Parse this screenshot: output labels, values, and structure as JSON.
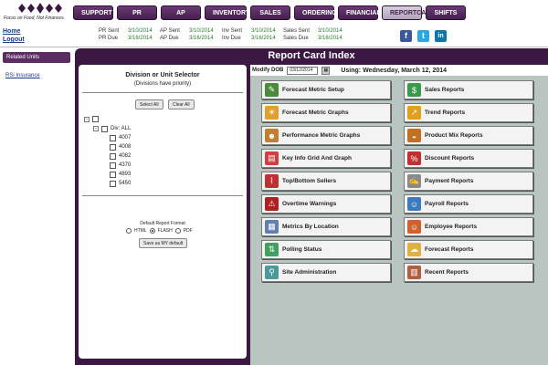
{
  "logo": {
    "tagline": "Focus on Food, Not Finances."
  },
  "nav": [
    {
      "label": "SUPPORT",
      "active": false
    },
    {
      "label": "PR",
      "active": false
    },
    {
      "label": "AP",
      "active": false
    },
    {
      "label": "INVENTORY",
      "active": false
    },
    {
      "label": "SALES",
      "active": false
    },
    {
      "label": "ORDERING",
      "active": false
    },
    {
      "label": "FINANCIALS",
      "active": false
    },
    {
      "label": "REPORTCARD",
      "active": true
    },
    {
      "label": "SHIFTS",
      "active": false
    }
  ],
  "toplinks": {
    "home": "Home",
    "logout": "Logout"
  },
  "status": {
    "pr_sent_label": "PR Sent",
    "pr_sent": "3/10/2014",
    "pr_due_label": "PR Due",
    "pr_due": "3/16/2014",
    "ap_sent_label": "AP Sent",
    "ap_sent": "3/10/2014",
    "ap_due_label": "AP Due",
    "ap_due": "3/16/2014",
    "inv_sent_label": "Inv Sent",
    "inv_sent": "3/10/2014",
    "inv_due_label": "Inv Due",
    "inv_due": "3/16/2014",
    "sales_sent_label": "Sales Sent",
    "sales_sent": "3/10/2014",
    "sales_due_label": "Sales Due",
    "sales_due": "3/16/2014"
  },
  "social": {
    "facebook": "f",
    "twitter": "t",
    "linkedin": "in"
  },
  "sidebar": {
    "related_units": "Related Units",
    "rsi_link": "RSi Insurance"
  },
  "main": {
    "title": "Report Card Index"
  },
  "selector": {
    "title": "Division or Unit Selector",
    "subtitle": "(Divisions have priority)",
    "select_all": "Select All",
    "clear_all": "Clear All",
    "div_label": "Div: ALL",
    "units": [
      "4007",
      "4008",
      "4082",
      "4370",
      "4893",
      "5450"
    ],
    "format_label": "Default Report Format",
    "formats": [
      {
        "label": "HTML",
        "selected": false
      },
      {
        "label": "FLASH",
        "selected": true
      },
      {
        "label": "PDF",
        "selected": false
      }
    ],
    "save_default": "Save as MY default"
  },
  "reports": {
    "dob_label": "Modify DOB",
    "dob_value": "03/12/2014",
    "using": "Using: Wednesday, March 12, 2014",
    "left": [
      {
        "label": "Forecast Metric Setup",
        "icon": "pencil-chart-icon"
      },
      {
        "label": "Forecast Metric Graphs",
        "icon": "weather-icon"
      },
      {
        "label": "Performance Metric Graphs",
        "icon": "people-icon"
      },
      {
        "label": "Key Info Grid And Graph",
        "icon": "chart-grid-icon"
      },
      {
        "label": "Top/Bottom Sellers",
        "icon": "line-chart-icon"
      },
      {
        "label": "Overtime Warnings",
        "icon": "warning-icon"
      },
      {
        "label": "Metrics By Location",
        "icon": "grid-icon"
      },
      {
        "label": "Polling Status",
        "icon": "polling-icon"
      },
      {
        "label": "Site Administration",
        "icon": "magnifier-icon"
      }
    ],
    "right": [
      {
        "label": "Sales Reports",
        "icon": "dollar-icon"
      },
      {
        "label": "Trend Reports",
        "icon": "trend-icon"
      },
      {
        "label": "Product Mix Reports",
        "icon": "burger-icon"
      },
      {
        "label": "Discount Reports",
        "icon": "discount-icon"
      },
      {
        "label": "Payment Reports",
        "icon": "payment-icon"
      },
      {
        "label": "Payroll Reports",
        "icon": "payroll-icon"
      },
      {
        "label": "Employee Reports",
        "icon": "employee-icon"
      },
      {
        "label": "Forecast Reports",
        "icon": "forecast-icon"
      },
      {
        "label": "Recent Reports",
        "icon": "recent-icon"
      }
    ]
  }
}
